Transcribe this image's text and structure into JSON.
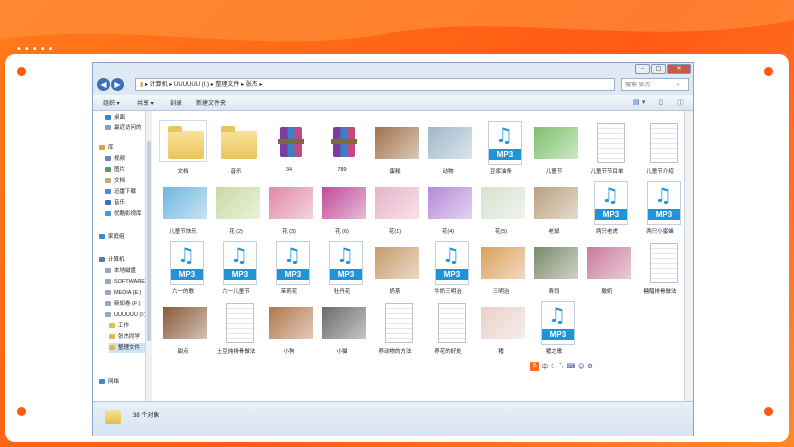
{
  "address": {
    "segments": [
      "计算机",
      "UUUUUU (I:)",
      "整理文件",
      "张杰"
    ],
    "search_placeholder": "搜索 张杰"
  },
  "toolbar": {
    "organize": "组织 ▾",
    "share": "共享 ▾",
    "burn": "刻录",
    "new_folder": "新建文件夹"
  },
  "nav": {
    "favorites": [
      "桌面",
      "最近访问的"
    ],
    "libraries_title": "库",
    "libraries": [
      "视频",
      "图片",
      "文档",
      "迅雷下载",
      "音乐",
      "优酷影视库"
    ],
    "homegroup": "家庭组",
    "computer_title": "计算机",
    "drives": [
      "本地磁盘",
      "SOFTWARE",
      "MEDIA (E:)",
      "新加卷 (F:)",
      "UUUUUU (I:)"
    ],
    "folders": [
      "工作",
      "张杰同学",
      "整理文件"
    ],
    "network": "网络"
  },
  "files": [
    {
      "name": "文档",
      "kind": "folder"
    },
    {
      "name": "音乐",
      "kind": "folder"
    },
    {
      "name": "34",
      "kind": "rar"
    },
    {
      "name": "789",
      "kind": "rar"
    },
    {
      "name": "蛋糕",
      "kind": "photo",
      "color": "#a0714a"
    },
    {
      "name": "动物",
      "kind": "photo",
      "color": "#9fb8c9"
    },
    {
      "name": "豆浆油条",
      "kind": "mp3"
    },
    {
      "name": "儿童节",
      "kind": "photo",
      "color": "#7cc06a"
    },
    {
      "name": "儿童节节目单",
      "kind": "doc"
    },
    {
      "name": "儿童节介绍",
      "kind": "doc"
    },
    {
      "name": "儿童节快乐",
      "kind": "photo",
      "color": "#6fb6e0"
    },
    {
      "name": "花 (2)",
      "kind": "photo",
      "color": "#c9d9a0"
    },
    {
      "name": "花 (3)",
      "kind": "photo",
      "color": "#e08aa8"
    },
    {
      "name": "花 (6)",
      "kind": "photo",
      "color": "#c04a9a"
    },
    {
      "name": "花(1)",
      "kind": "photo",
      "color": "#e8b2c8"
    },
    {
      "name": "花(4)",
      "kind": "photo",
      "color": "#b48ad8"
    },
    {
      "name": "花(5)",
      "kind": "photo",
      "color": "#d8e0d0"
    },
    {
      "name": "老鼠",
      "kind": "photo",
      "color": "#b8a080"
    },
    {
      "name": "两只老虎",
      "kind": "mp3"
    },
    {
      "name": "两只小蜜蜂",
      "kind": "mp3"
    },
    {
      "name": "六一的歌",
      "kind": "mp3"
    },
    {
      "name": "六一儿童节",
      "kind": "mp3"
    },
    {
      "name": "茉莉花",
      "kind": "mp3"
    },
    {
      "name": "牡丹花",
      "kind": "mp3"
    },
    {
      "name": "奶茶",
      "kind": "photo",
      "color": "#c89a6a"
    },
    {
      "name": "牛奶三明治",
      "kind": "mp3"
    },
    {
      "name": "三明治",
      "kind": "photo",
      "color": "#d9a05a"
    },
    {
      "name": "寿司",
      "kind": "photo",
      "color": "#7a8a6a"
    },
    {
      "name": "酸奶",
      "kind": "photo",
      "color": "#c87a9a"
    },
    {
      "name": "糖醋排骨做法",
      "kind": "doc"
    },
    {
      "name": "甜点",
      "kind": "photo",
      "color": "#8a5a3a"
    },
    {
      "name": "土豆炖排骨做法",
      "kind": "doc"
    },
    {
      "name": "小狗",
      "kind": "photo",
      "color": "#b0764a"
    },
    {
      "name": "小猫",
      "kind": "photo",
      "color": "#6a6a6a"
    },
    {
      "name": "养动物的方法",
      "kind": "doc"
    },
    {
      "name": "养花的好处",
      "kind": "doc"
    },
    {
      "name": "猪",
      "kind": "photo",
      "color": "#e8d0c8"
    },
    {
      "name": "猪之歌",
      "kind": "mp3"
    }
  ],
  "status": {
    "count": "38 个对象"
  },
  "ime": {
    "lang": "中"
  },
  "colors": {
    "accent": "#ff5a14",
    "mp3_blue": "#1f95d8"
  }
}
